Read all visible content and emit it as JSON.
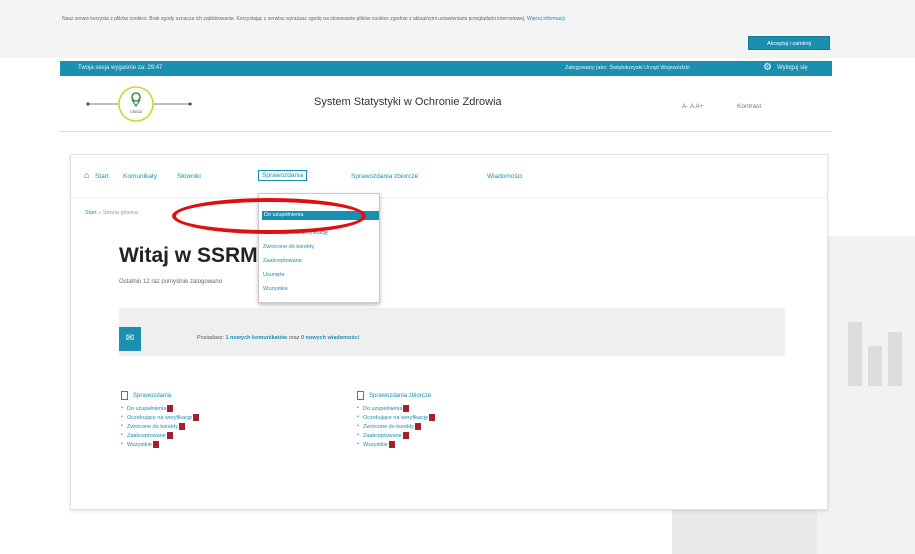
{
  "cookie": {
    "text": "Nasz serwis korzysta z plików cookies. Brak zgody oznacza ich zablokowanie. Korzystając z serwisu wyrażasz zgodę na stosowanie plików cookies zgodnie z aktualnymi ustawieniami przeglądarki internetowej.",
    "link_label": "Więcej informacji",
    "button_label": "Akceptuj i zamknij"
  },
  "topbar": {
    "session": "Twoja sesja wygaśnie za: 29:47",
    "logged_as": "Zalogowany jako: Świętokrzyski Urząd Wojewódzki",
    "logout": "Wyloguj się"
  },
  "header": {
    "logo_text": "CSIOZ",
    "title": "System Statystyki w Ochronie Zdrowia",
    "font_size": "A- A A+",
    "contrast": "Kontrast"
  },
  "nav": {
    "home": "Start",
    "items": [
      "Komunikaty",
      "Słowniki",
      "Sprawozdania",
      "Sprawozdania zbiorcze",
      "Wiadomości"
    ]
  },
  "breadcrumb": {
    "home": "Start",
    "current": "Strona główna"
  },
  "welcome": {
    "title": "Witaj w SSRMZ!",
    "last_login": "Ostatnio 12 raz pomyślnie zalogowano"
  },
  "dropdown": {
    "items": [
      "Do uzupełnienia",
      "Oczekujące na weryfikację",
      "Zwrócone do korekty",
      "Zaakceptowane",
      "Usunięte",
      "Wszystkie"
    ]
  },
  "notice": {
    "text_prefix": "Posiadasz:",
    "unread_announcements": "1 nowych komunikatów",
    "text_middle": "oraz",
    "unread_messages": "0 nowych wiadomości"
  },
  "columns": [
    {
      "title": "Sprawozdania",
      "items": [
        "Do uzupełnienia",
        "Oczekujące na weryfikację",
        "Zwrócone do korekty",
        "Zaakceptowane",
        "Wszystkie"
      ]
    },
    {
      "title": "Sprawozdania zbiorcze",
      "items": [
        "Do uzupełnienia",
        "Oczekujące na weryfikację",
        "Zwrócone do korekty",
        "Zaakceptowane",
        "Wszystkie"
      ]
    }
  ],
  "colors": {
    "accent": "#1b8fb0",
    "badge": "#a5202e",
    "highlight": "#e01010"
  }
}
